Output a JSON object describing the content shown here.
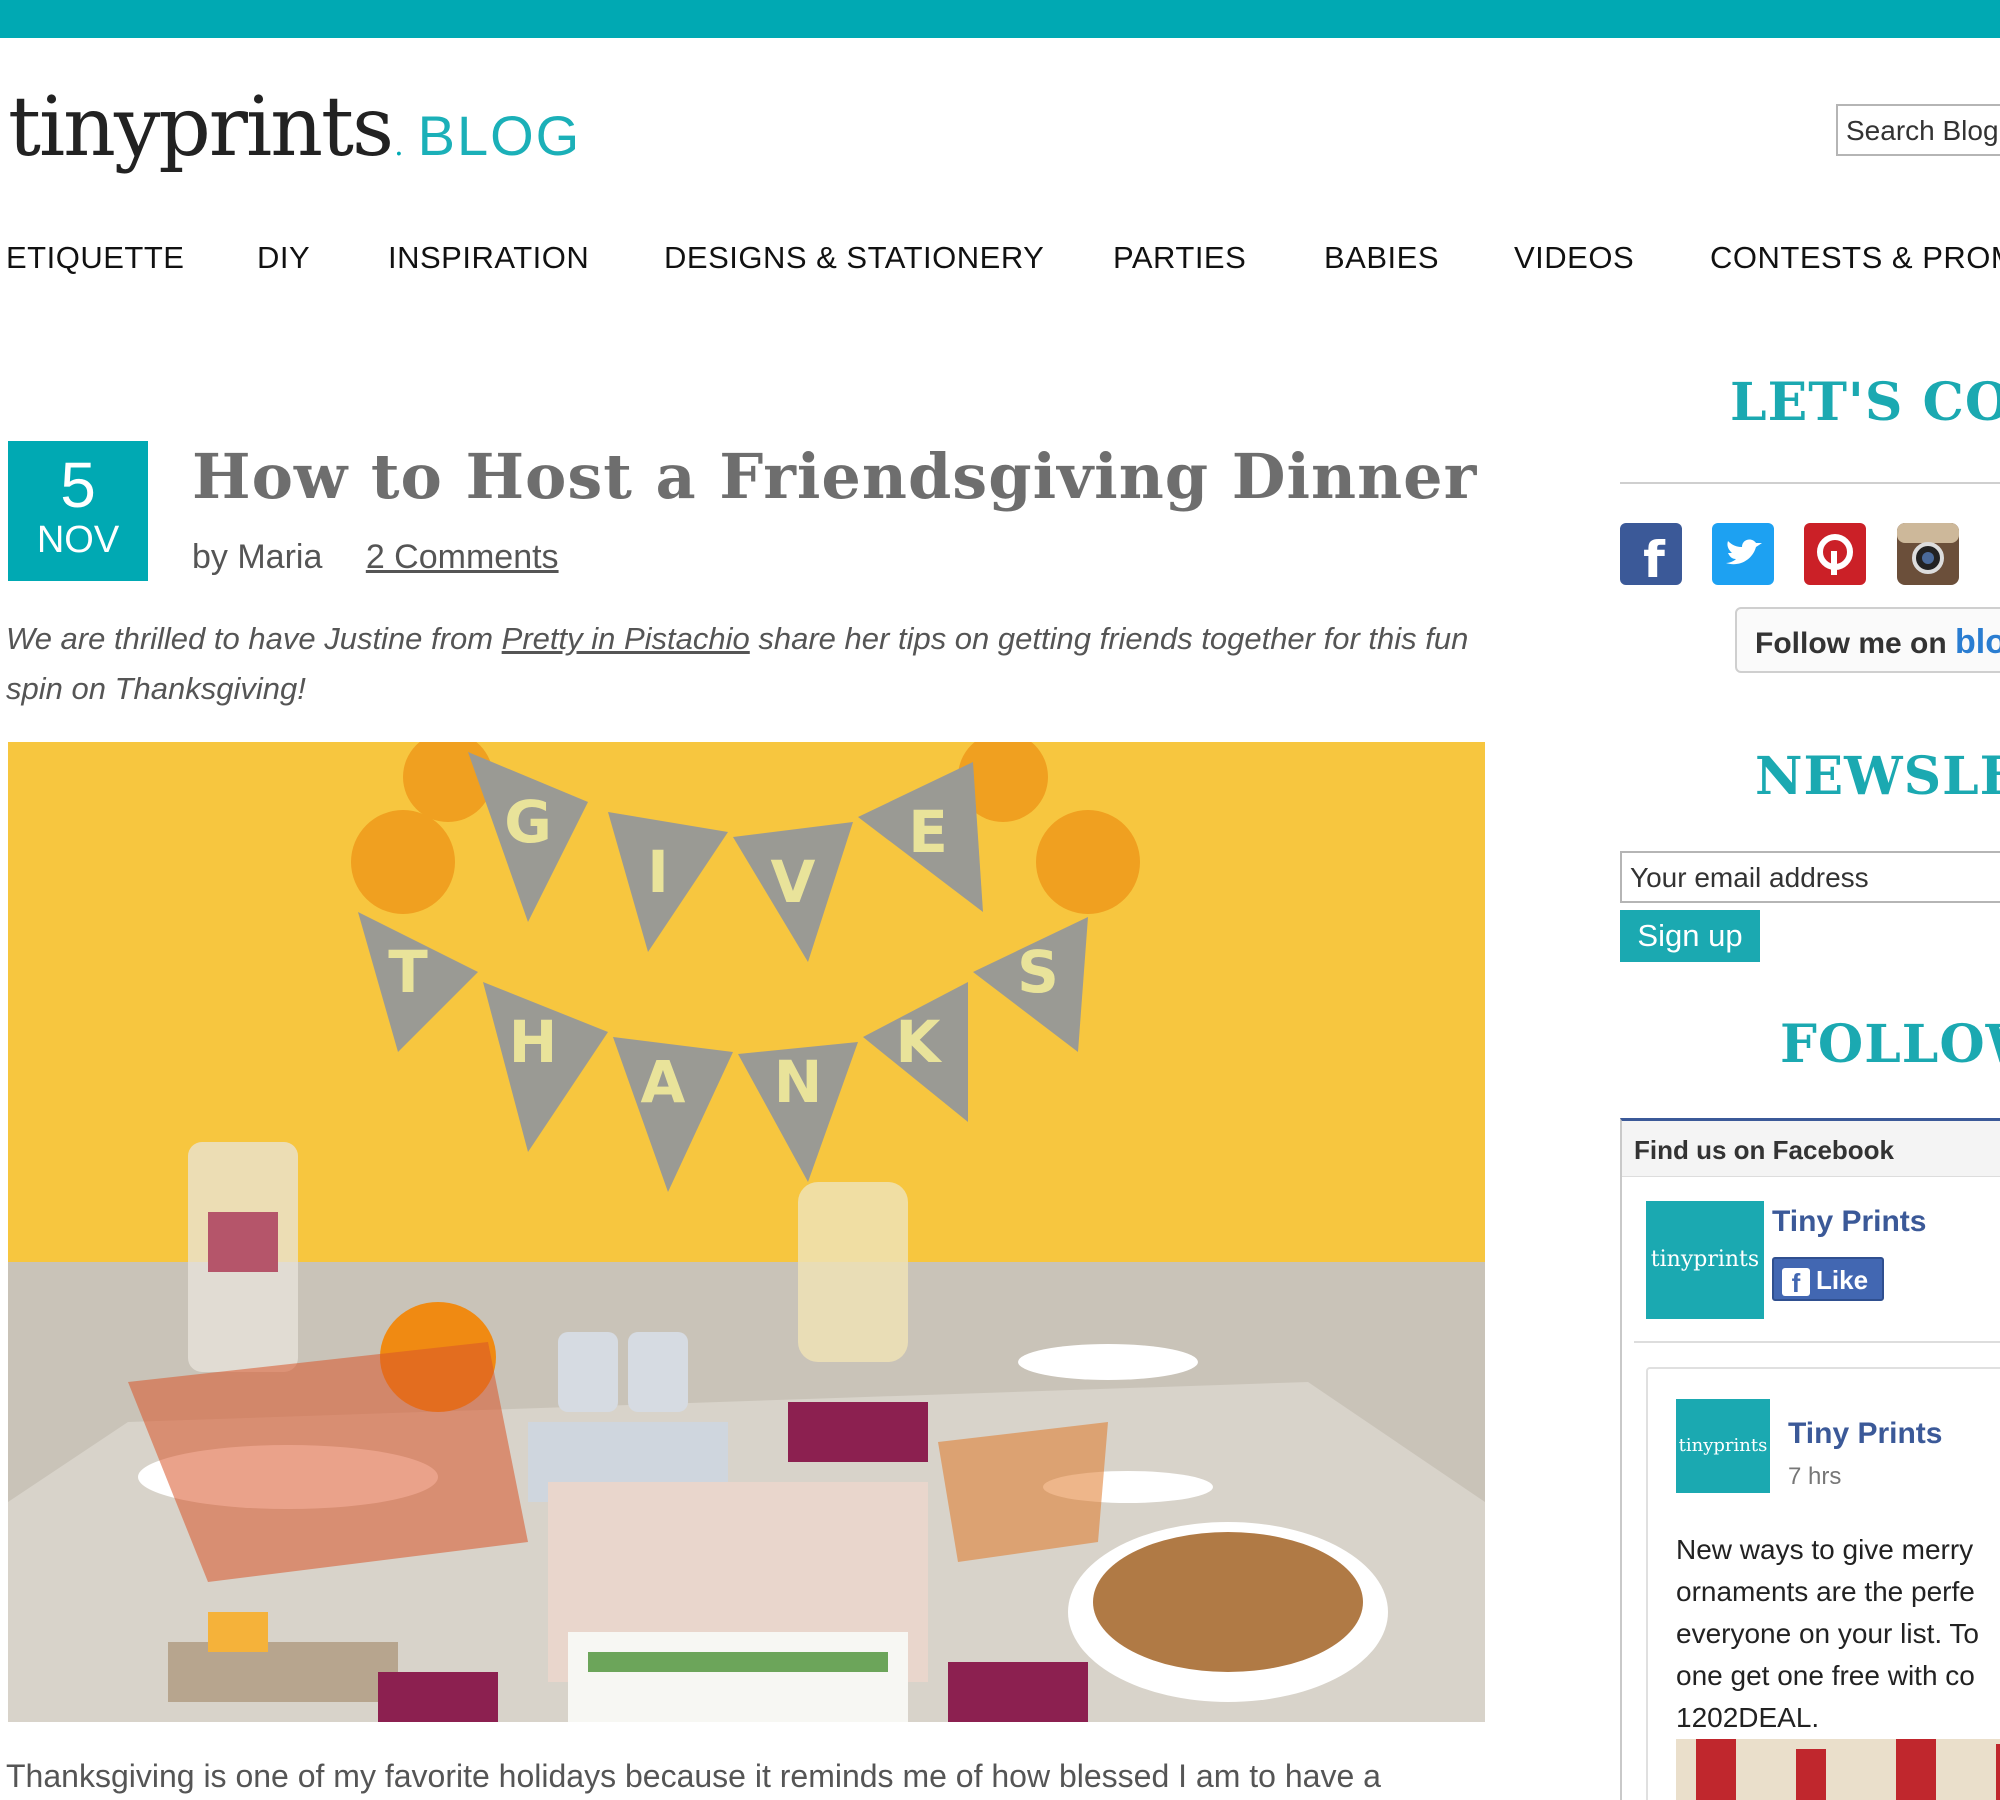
{
  "header": {
    "logo_text": "tinyprints",
    "logo_dot": ".",
    "blog_label": "BLOG",
    "search_placeholder": "Search Blog"
  },
  "nav": {
    "items": [
      "ETIQUETTE",
      "DIY",
      "INSPIRATION",
      "DESIGNS & STATIONERY",
      "PARTIES",
      "BABIES",
      "VIDEOS",
      "CONTESTS & PROM"
    ]
  },
  "post": {
    "date_day": "5",
    "date_month": "NOV",
    "title": "How to Host a Friendsgiving Dinner",
    "author": "by Maria",
    "comments": "2 Comments",
    "intro_before": "We are thrilled to have Justine from ",
    "intro_link": "Pretty in Pistachio",
    "intro_after": " share her tips on getting friends together for this fun spin on Thanksgiving!",
    "body_first_line": "Thanksgiving is one of my favorite holidays because it reminds me of how blessed I am to have a",
    "banner_letters": [
      "G",
      "I",
      "V",
      "E",
      "T",
      "H",
      "A",
      "N",
      "K",
      "S"
    ]
  },
  "sidebar": {
    "connect_heading": "LET'S CON",
    "social_icons": [
      "facebook-icon",
      "twitter-icon",
      "pinterest-icon",
      "instagram-icon"
    ],
    "follow_text": "Follow me on ",
    "follow_brand": "blo",
    "newsletter_heading": "NEWSLET",
    "email_placeholder": "Your email address",
    "signup_label": "Sign up",
    "follow_heading": "FOLLOW",
    "facebook": {
      "header": "Find us on Facebook",
      "page_name": "Tiny Prints",
      "thumb_text": "tinyprints",
      "like_label": "Like",
      "post_name": "Tiny Prints",
      "post_time": "7 hrs",
      "post_lines": [
        "New ways to give merry",
        "ornaments are the perfe",
        "everyone on your list. To",
        "one get one free with co",
        "1202DEAL."
      ]
    }
  },
  "colors": {
    "accent": "#00a9b3",
    "facebook": "#3b5998"
  }
}
